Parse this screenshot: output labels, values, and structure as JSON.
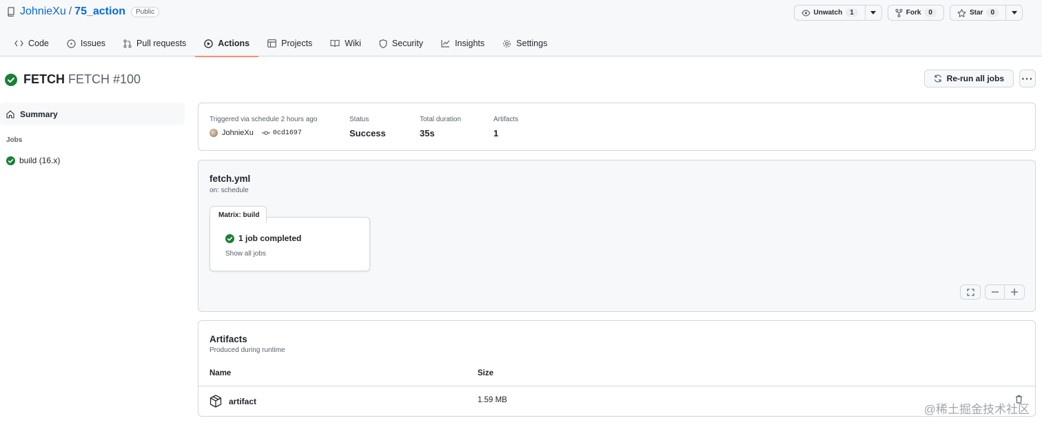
{
  "repo": {
    "owner": "JohnieXu",
    "separator": "/",
    "name": "75_action",
    "visibility": "Public"
  },
  "repo_actions": [
    {
      "label": "Unwatch",
      "count": "1",
      "icon": "eye-icon",
      "has_caret": true
    },
    {
      "label": "Fork",
      "count": "0",
      "icon": "fork-icon",
      "has_caret": false
    },
    {
      "label": "Star",
      "count": "0",
      "icon": "star-icon",
      "has_caret": true
    }
  ],
  "tabs": [
    {
      "label": "Code",
      "icon": "code-icon"
    },
    {
      "label": "Issues",
      "icon": "issue-icon"
    },
    {
      "label": "Pull requests",
      "icon": "pull-request-icon"
    },
    {
      "label": "Actions",
      "icon": "play-icon",
      "active": true
    },
    {
      "label": "Projects",
      "icon": "table-icon"
    },
    {
      "label": "Wiki",
      "icon": "book-icon"
    },
    {
      "label": "Security",
      "icon": "shield-icon"
    },
    {
      "label": "Insights",
      "icon": "graph-icon"
    },
    {
      "label": "Settings",
      "icon": "gear-icon"
    }
  ],
  "run": {
    "workflow": "FETCH",
    "name": "FETCH #100",
    "rerun_label": "Re-run all jobs",
    "more_label": "···"
  },
  "sidebar": {
    "summary": "Summary",
    "jobs_label": "Jobs",
    "jobs": [
      {
        "label": "build (16.x)",
        "status": "success"
      }
    ]
  },
  "summary": {
    "trigger": "Triggered via schedule 2 hours ago",
    "actor": "JohnieXu",
    "sha": "0cd1697",
    "status_label": "Status",
    "status_value": "Success",
    "duration_label": "Total duration",
    "duration_value": "35s",
    "artifacts_label": "Artifacts",
    "artifacts_value": "1"
  },
  "workflow": {
    "file": "fetch.yml",
    "trigger": "on: schedule",
    "matrix_label": "Matrix: build",
    "jobs_completed": "1 job completed",
    "show_all": "Show all jobs"
  },
  "artifacts": {
    "title": "Artifacts",
    "subtitle": "Produced during runtime",
    "col_name": "Name",
    "col_size": "Size",
    "rows": [
      {
        "name": "artifact",
        "size": "1.59 MB"
      }
    ]
  },
  "watermark": "@稀土掘金技术社区",
  "colors": {
    "success": "#1a7f37",
    "link": "#0969da",
    "active_tab": "#fd8c73"
  }
}
